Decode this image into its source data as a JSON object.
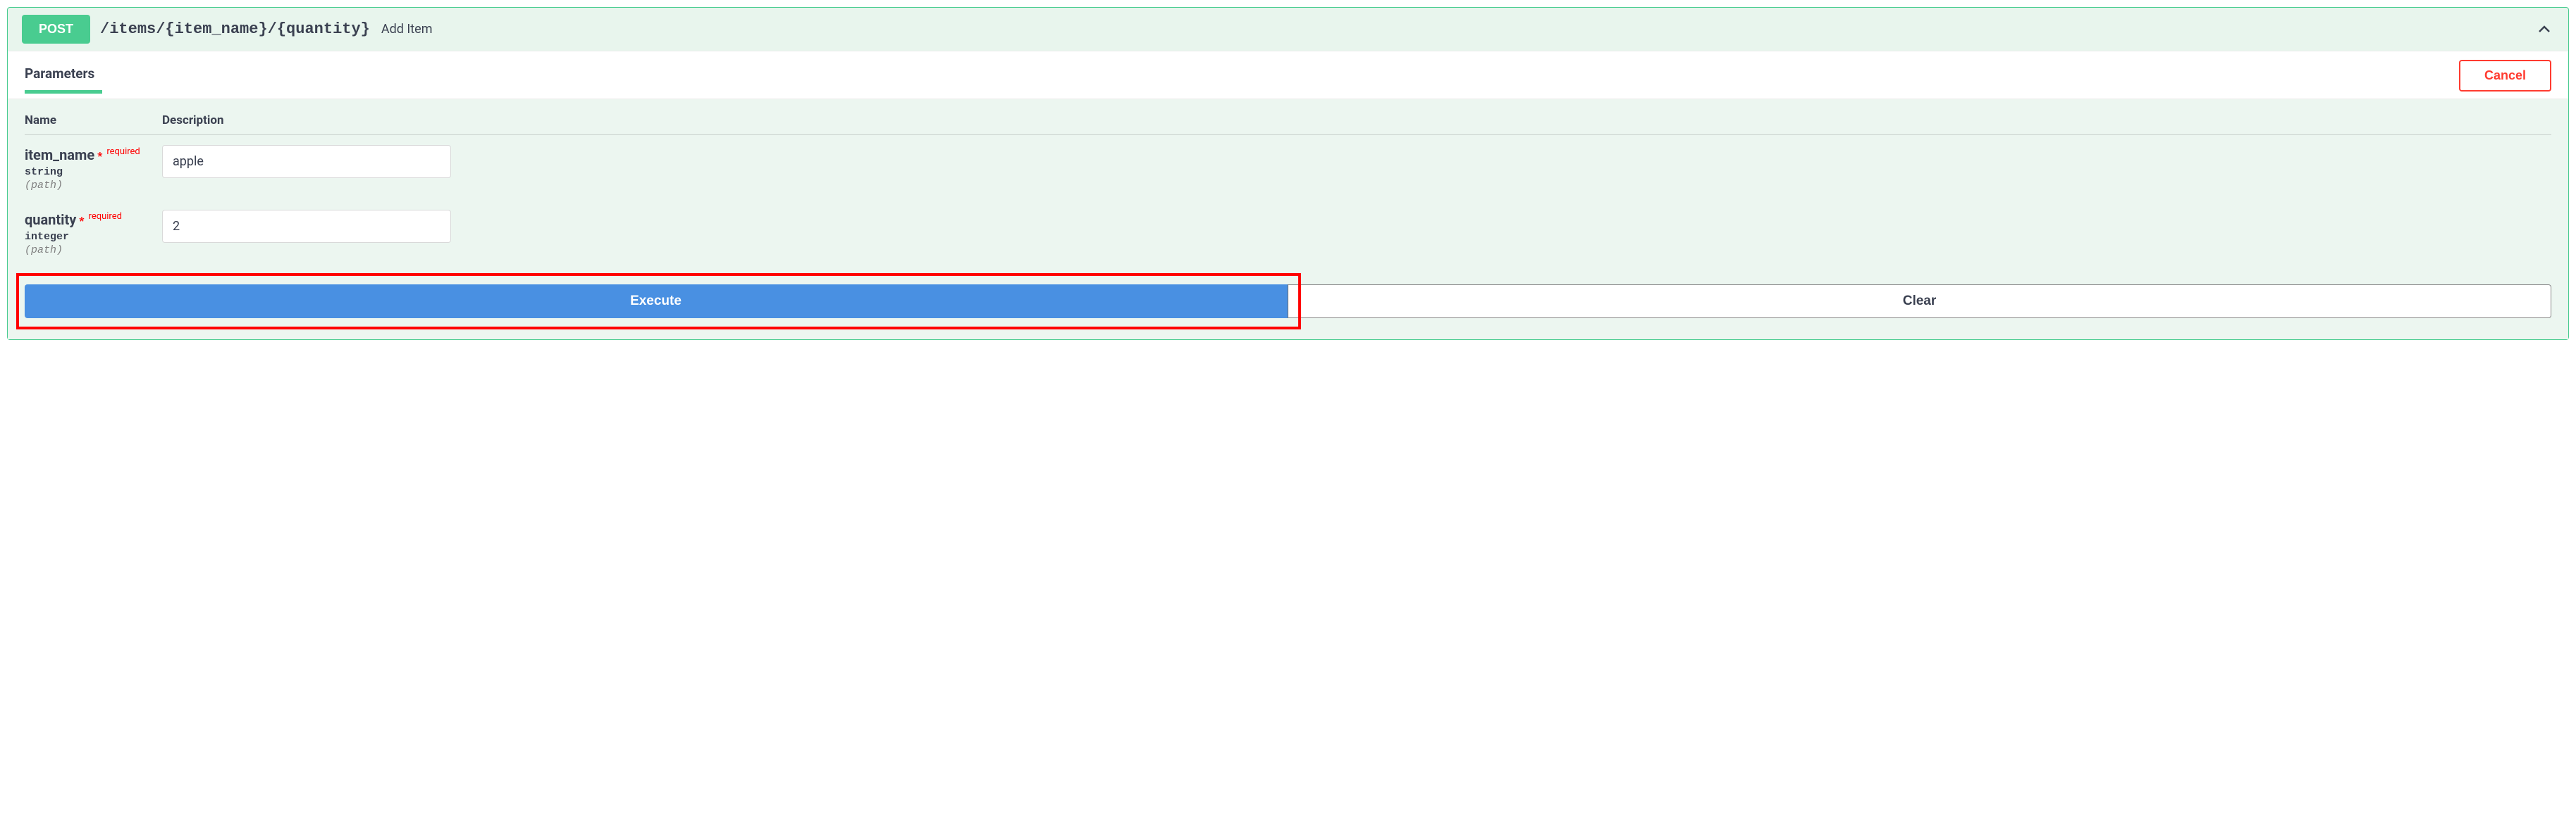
{
  "operation": {
    "method": "POST",
    "path": "/items/{item_name}/{quantity}",
    "summary": "Add Item"
  },
  "tabs": {
    "parameters_label": "Parameters"
  },
  "buttons": {
    "cancel": "Cancel",
    "execute": "Execute",
    "clear": "Clear"
  },
  "columns": {
    "name": "Name",
    "description": "Description"
  },
  "labels": {
    "required": "required"
  },
  "parameters": [
    {
      "name": "item_name",
      "type": "string",
      "in": "(path)",
      "required": true,
      "value": "apple"
    },
    {
      "name": "quantity",
      "type": "integer",
      "in": "(path)",
      "required": true,
      "value": "2"
    }
  ]
}
